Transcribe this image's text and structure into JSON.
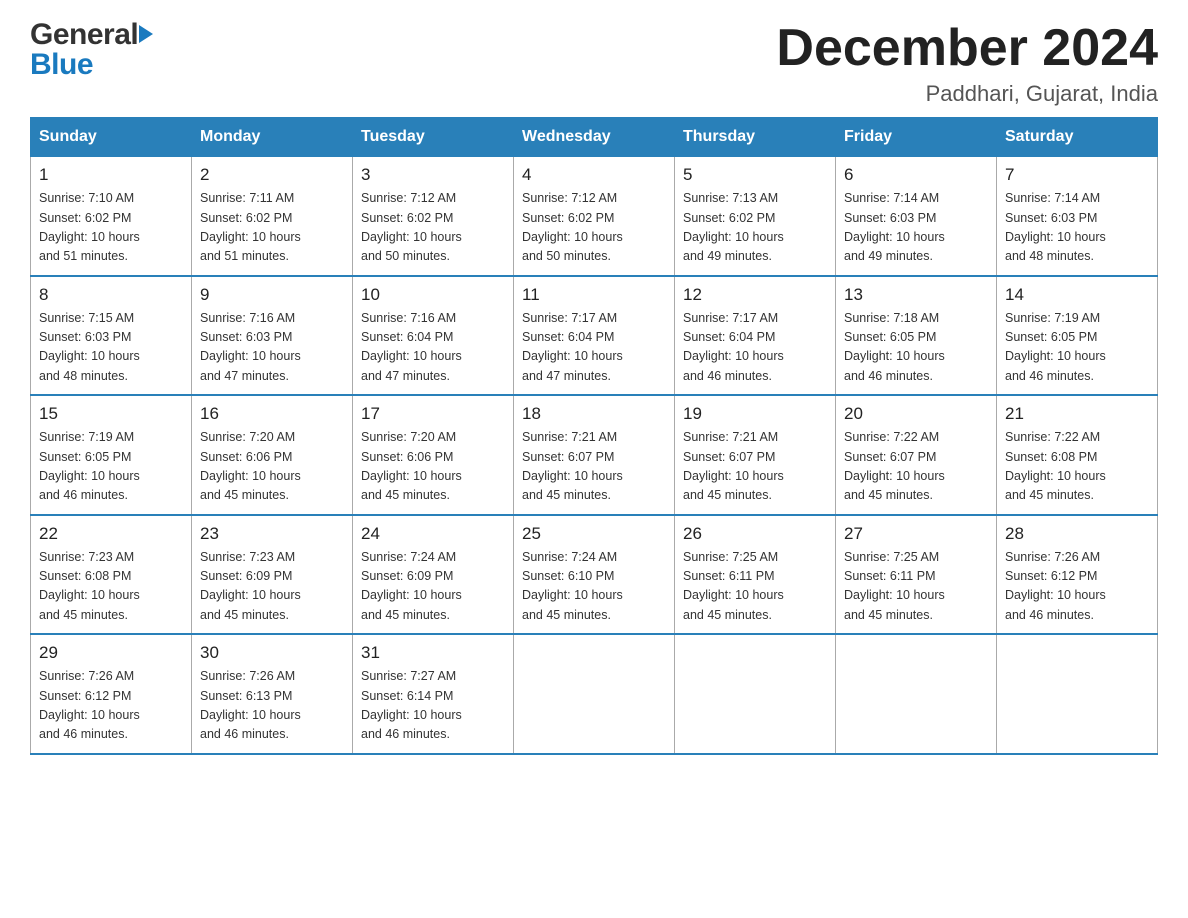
{
  "header": {
    "logo_general": "General",
    "logo_blue": "Blue",
    "month_title": "December 2024",
    "location": "Paddhari, Gujarat, India"
  },
  "calendar": {
    "days_of_week": [
      "Sunday",
      "Monday",
      "Tuesday",
      "Wednesday",
      "Thursday",
      "Friday",
      "Saturday"
    ],
    "weeks": [
      [
        {
          "day": "1",
          "sunrise": "7:10 AM",
          "sunset": "6:02 PM",
          "daylight": "10 hours and 51 minutes."
        },
        {
          "day": "2",
          "sunrise": "7:11 AM",
          "sunset": "6:02 PM",
          "daylight": "10 hours and 51 minutes."
        },
        {
          "day": "3",
          "sunrise": "7:12 AM",
          "sunset": "6:02 PM",
          "daylight": "10 hours and 50 minutes."
        },
        {
          "day": "4",
          "sunrise": "7:12 AM",
          "sunset": "6:02 PM",
          "daylight": "10 hours and 50 minutes."
        },
        {
          "day": "5",
          "sunrise": "7:13 AM",
          "sunset": "6:02 PM",
          "daylight": "10 hours and 49 minutes."
        },
        {
          "day": "6",
          "sunrise": "7:14 AM",
          "sunset": "6:03 PM",
          "daylight": "10 hours and 49 minutes."
        },
        {
          "day": "7",
          "sunrise": "7:14 AM",
          "sunset": "6:03 PM",
          "daylight": "10 hours and 48 minutes."
        }
      ],
      [
        {
          "day": "8",
          "sunrise": "7:15 AM",
          "sunset": "6:03 PM",
          "daylight": "10 hours and 48 minutes."
        },
        {
          "day": "9",
          "sunrise": "7:16 AM",
          "sunset": "6:03 PM",
          "daylight": "10 hours and 47 minutes."
        },
        {
          "day": "10",
          "sunrise": "7:16 AM",
          "sunset": "6:04 PM",
          "daylight": "10 hours and 47 minutes."
        },
        {
          "day": "11",
          "sunrise": "7:17 AM",
          "sunset": "6:04 PM",
          "daylight": "10 hours and 47 minutes."
        },
        {
          "day": "12",
          "sunrise": "7:17 AM",
          "sunset": "6:04 PM",
          "daylight": "10 hours and 46 minutes."
        },
        {
          "day": "13",
          "sunrise": "7:18 AM",
          "sunset": "6:05 PM",
          "daylight": "10 hours and 46 minutes."
        },
        {
          "day": "14",
          "sunrise": "7:19 AM",
          "sunset": "6:05 PM",
          "daylight": "10 hours and 46 minutes."
        }
      ],
      [
        {
          "day": "15",
          "sunrise": "7:19 AM",
          "sunset": "6:05 PM",
          "daylight": "10 hours and 46 minutes."
        },
        {
          "day": "16",
          "sunrise": "7:20 AM",
          "sunset": "6:06 PM",
          "daylight": "10 hours and 45 minutes."
        },
        {
          "day": "17",
          "sunrise": "7:20 AM",
          "sunset": "6:06 PM",
          "daylight": "10 hours and 45 minutes."
        },
        {
          "day": "18",
          "sunrise": "7:21 AM",
          "sunset": "6:07 PM",
          "daylight": "10 hours and 45 minutes."
        },
        {
          "day": "19",
          "sunrise": "7:21 AM",
          "sunset": "6:07 PM",
          "daylight": "10 hours and 45 minutes."
        },
        {
          "day": "20",
          "sunrise": "7:22 AM",
          "sunset": "6:07 PM",
          "daylight": "10 hours and 45 minutes."
        },
        {
          "day": "21",
          "sunrise": "7:22 AM",
          "sunset": "6:08 PM",
          "daylight": "10 hours and 45 minutes."
        }
      ],
      [
        {
          "day": "22",
          "sunrise": "7:23 AM",
          "sunset": "6:08 PM",
          "daylight": "10 hours and 45 minutes."
        },
        {
          "day": "23",
          "sunrise": "7:23 AM",
          "sunset": "6:09 PM",
          "daylight": "10 hours and 45 minutes."
        },
        {
          "day": "24",
          "sunrise": "7:24 AM",
          "sunset": "6:09 PM",
          "daylight": "10 hours and 45 minutes."
        },
        {
          "day": "25",
          "sunrise": "7:24 AM",
          "sunset": "6:10 PM",
          "daylight": "10 hours and 45 minutes."
        },
        {
          "day": "26",
          "sunrise": "7:25 AM",
          "sunset": "6:11 PM",
          "daylight": "10 hours and 45 minutes."
        },
        {
          "day": "27",
          "sunrise": "7:25 AM",
          "sunset": "6:11 PM",
          "daylight": "10 hours and 45 minutes."
        },
        {
          "day": "28",
          "sunrise": "7:26 AM",
          "sunset": "6:12 PM",
          "daylight": "10 hours and 46 minutes."
        }
      ],
      [
        {
          "day": "29",
          "sunrise": "7:26 AM",
          "sunset": "6:12 PM",
          "daylight": "10 hours and 46 minutes."
        },
        {
          "day": "30",
          "sunrise": "7:26 AM",
          "sunset": "6:13 PM",
          "daylight": "10 hours and 46 minutes."
        },
        {
          "day": "31",
          "sunrise": "7:27 AM",
          "sunset": "6:14 PM",
          "daylight": "10 hours and 46 minutes."
        },
        null,
        null,
        null,
        null
      ]
    ],
    "sunrise_label": "Sunrise:",
    "sunset_label": "Sunset:",
    "daylight_label": "Daylight:"
  }
}
